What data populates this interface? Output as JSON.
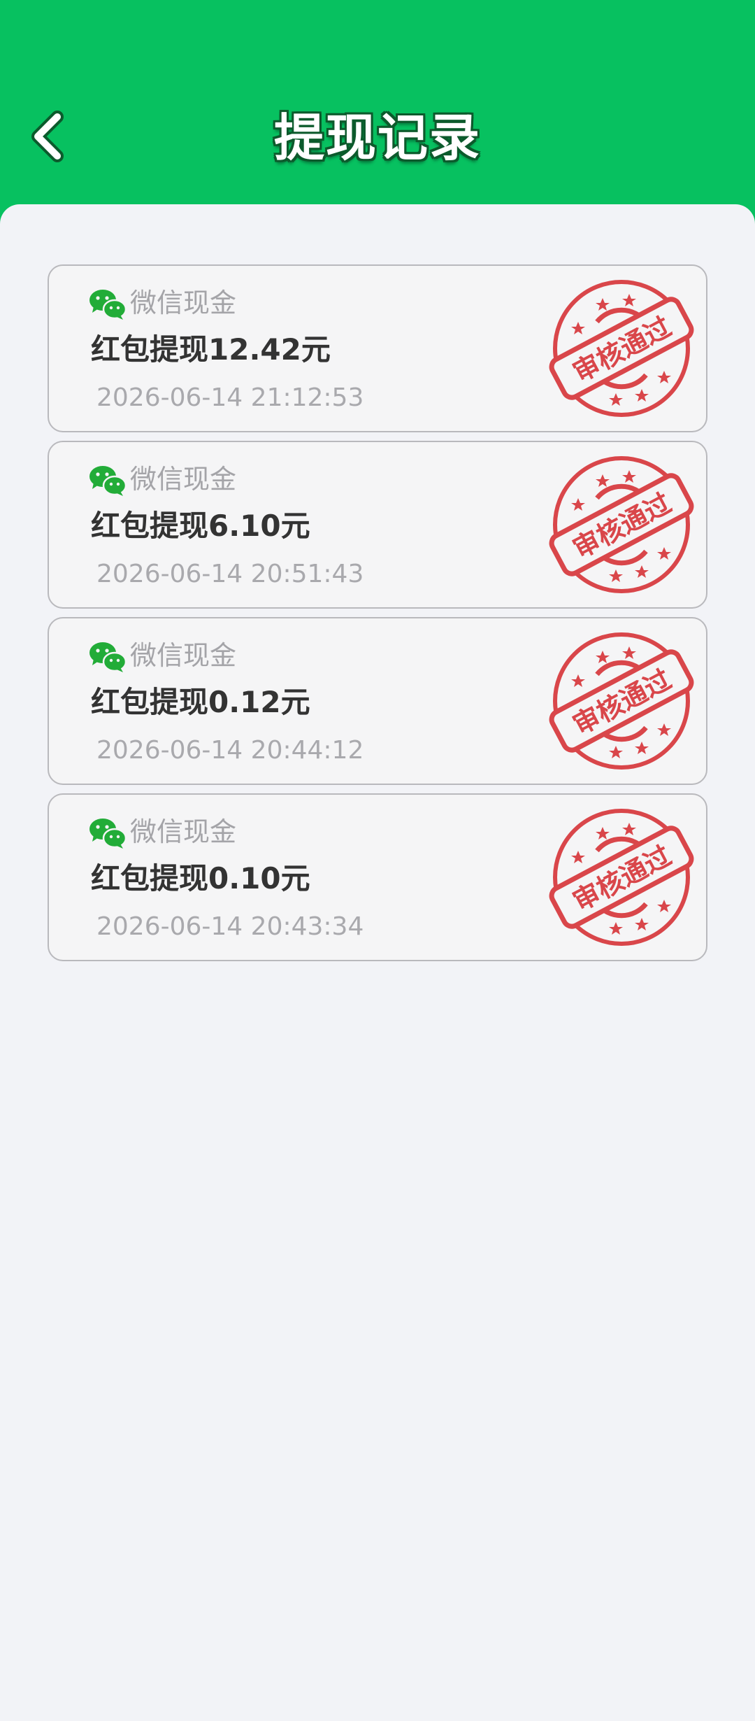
{
  "header": {
    "title": "提现记录",
    "back_icon": "chevron-left-icon"
  },
  "colors": {
    "brand_green": "#07c160",
    "stamp_red": "#d9464a",
    "background": "#f2f3f7"
  },
  "records": [
    {
      "method": "微信现金",
      "amount": "红包提现12.42元",
      "time": "2026-06-14 21:12:53",
      "status": "审核通过"
    },
    {
      "method": "微信现金",
      "amount": "红包提现6.10元",
      "time": "2026-06-14 20:51:43",
      "status": "审核通过"
    },
    {
      "method": "微信现金",
      "amount": "红包提现0.12元",
      "time": "2026-06-14 20:44:12",
      "status": "审核通过"
    },
    {
      "method": "微信现金",
      "amount": "红包提现0.10元",
      "time": "2026-06-14 20:43:34",
      "status": "审核通过"
    }
  ]
}
